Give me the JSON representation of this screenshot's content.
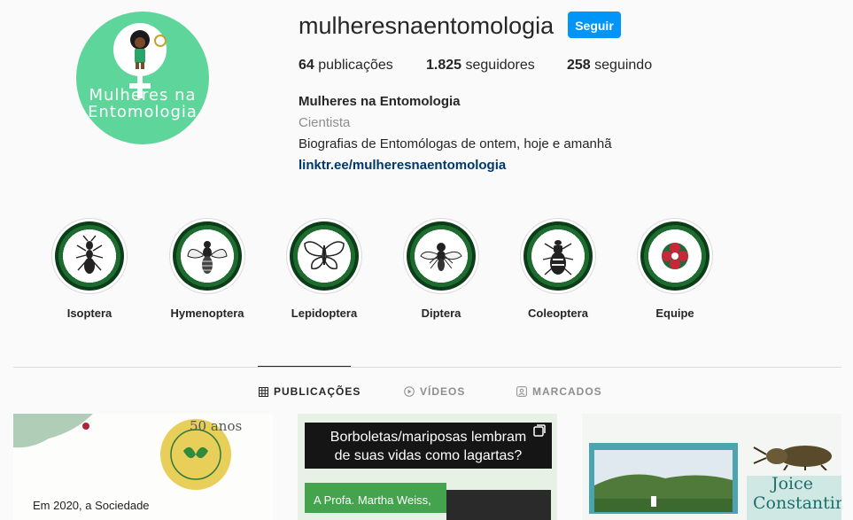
{
  "profile": {
    "username": "mulheresnaentomologia",
    "follow_label": "Seguir",
    "stats": [
      {
        "count": "64",
        "label": "publicações"
      },
      {
        "count": "1.825",
        "label": "seguidores"
      },
      {
        "count": "258",
        "label": "seguindo"
      }
    ],
    "full_name": "Mulheres na Entomologia",
    "category": "Cientista",
    "bio": "Biografias de Entomólogas de ontem, hoje e amanhã",
    "link": "linktr.ee/mulheresnaentomologia",
    "avatar_text_line1": "Mulheres na",
    "avatar_text_line2": "Entomologia"
  },
  "highlights": [
    {
      "label": "Isoptera",
      "icon": "termite-icon"
    },
    {
      "label": "Hymenoptera",
      "icon": "bee-icon"
    },
    {
      "label": "Lepidoptera",
      "icon": "butterfly-icon"
    },
    {
      "label": "Diptera",
      "icon": "fly-icon"
    },
    {
      "label": "Coleoptera",
      "icon": "beetle-icon"
    },
    {
      "label": "Equipe",
      "icon": "flower-icon"
    }
  ],
  "tabs": [
    {
      "label": "PUBLICAÇÕES",
      "icon": "grid-icon",
      "active": true
    },
    {
      "label": "VÍDEOS",
      "icon": "play-icon",
      "active": false
    },
    {
      "label": "MARCADOS",
      "icon": "tag-icon",
      "active": false
    }
  ],
  "posts": [
    {
      "badge": "50 anos",
      "text": "Em 2020, a Sociedade"
    },
    {
      "headline_line1": "Borboletas/mariposas lembram",
      "headline_line2": "de suas vidas como lagartas?",
      "caption": "A Profa. Martha Weiss,"
    },
    {
      "name_line1": "Joice",
      "name_line2": "Constantini"
    }
  ],
  "colors": {
    "accent": "#0095f6",
    "avatar_bg": "#5ed59a",
    "link": "#00376b",
    "highlight_ring": "#1d6b2f"
  }
}
